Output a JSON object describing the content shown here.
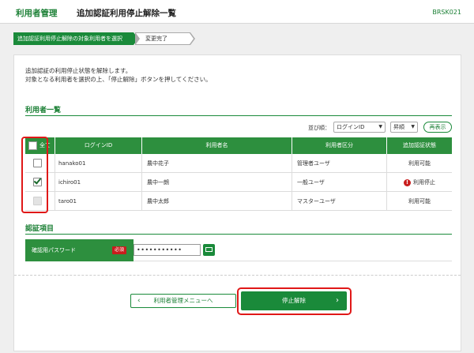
{
  "header": {
    "app_title": "利用者管理",
    "screen_title": "追加認証利用停止解除一覧",
    "screen_id": "BRSK021"
  },
  "steps": {
    "step1": "追加認証利用停止解除の対象利用者を選択",
    "step2": "変更完了"
  },
  "intro": {
    "line1": "追加認証の利用停止状態を解除します。",
    "line2": "対象となる利用者を選択の上、「停止解除」ボタンを押してください。"
  },
  "user_list": {
    "section_title": "利用者一覧",
    "sort_label": "並び順：",
    "sort_field": "ログインID",
    "sort_order": "昇順",
    "redisplay_label": "再表示",
    "columns": {
      "all": "全て",
      "login_id": "ログインID",
      "user_name": "利用者名",
      "user_type": "利用者区分",
      "status": "追加認証状態"
    },
    "rows": [
      {
        "login_id": "hanako01",
        "user_name": "農中花子",
        "user_type": "管理者ユーザ",
        "status": "利用可能",
        "checked": false,
        "disabled": false,
        "stopped": false
      },
      {
        "login_id": "ichiro01",
        "user_name": "農中一朗",
        "user_type": "一般ユーザ",
        "status": "利用停止",
        "checked": true,
        "disabled": false,
        "stopped": true
      },
      {
        "login_id": "taro01",
        "user_name": "農中太郎",
        "user_type": "マスターユーザ",
        "status": "利用可能",
        "checked": false,
        "disabled": true,
        "stopped": false
      }
    ]
  },
  "auth": {
    "section_title": "認証項目",
    "password_label": "確認用パスワード",
    "required_label": "必須",
    "password_value": "•••••••••••"
  },
  "buttons": {
    "back_label": "利用者管理メニューへ",
    "stop_release_label": "停止解除"
  },
  "colors": {
    "accent_green": "#1a8a3a",
    "highlight_red": "#e01818",
    "stop_red": "#c81d1d"
  }
}
